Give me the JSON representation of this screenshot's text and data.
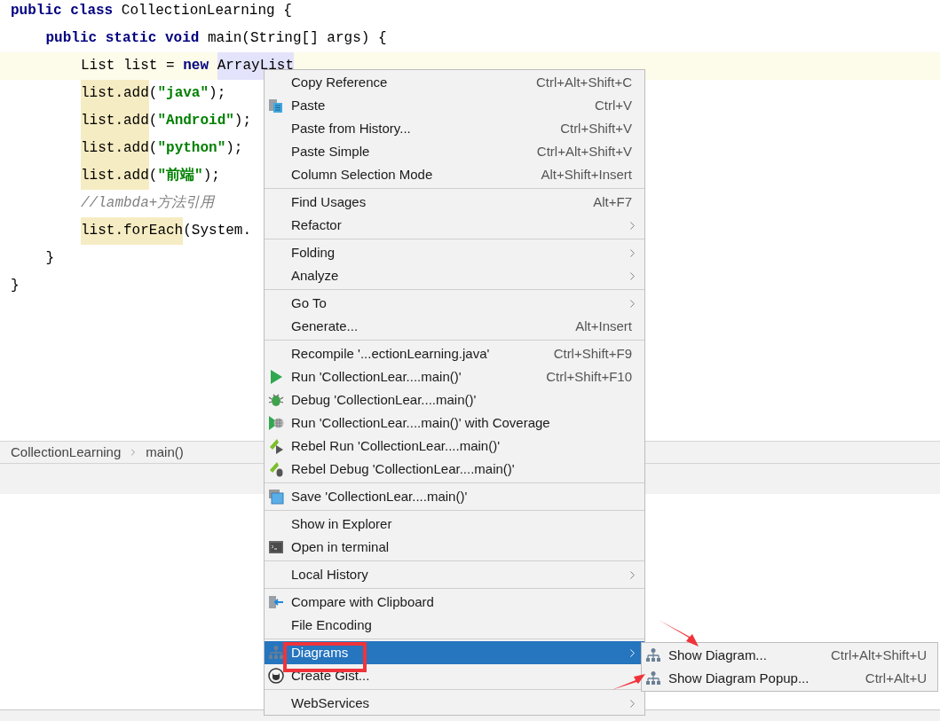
{
  "code": [
    {
      "segments": [
        {
          "text": "public class ",
          "kind": "keyword"
        },
        {
          "text": "CollectionLearning {",
          "kind": "plain"
        }
      ],
      "current": false,
      "children": [
        {
          "segments": [
            {
              "text": "public static void ",
              "kind": "keyword"
            },
            {
              "text": "main(String[] args) {",
              "kind": "plain"
            }
          ],
          "current": false,
          "children": [
            {
              "segments": [
                {
                  "text": "List list = ",
                  "kind": "plain"
                },
                {
                  "text": "new ",
                  "kind": "keyword"
                },
                {
                  "text": "ArrayList",
                  "kind": "reference"
                }
              ],
              "current": true
            },
            {
              "segments": [
                {
                  "text": "list.add",
                  "kind": "usage"
                },
                {
                  "text": "(",
                  "kind": "plain"
                },
                {
                  "text": "\"java\"",
                  "kind": "string"
                },
                {
                  "text": ");",
                  "kind": "plain"
                }
              ],
              "current": false
            },
            {
              "segments": [
                {
                  "text": "list.add",
                  "kind": "usage"
                },
                {
                  "text": "(",
                  "kind": "plain"
                },
                {
                  "text": "\"Android\"",
                  "kind": "string"
                },
                {
                  "text": ");",
                  "kind": "plain"
                }
              ],
              "current": false
            },
            {
              "segments": [
                {
                  "text": "list.add",
                  "kind": "usage"
                },
                {
                  "text": "(",
                  "kind": "plain"
                },
                {
                  "text": "\"python\"",
                  "kind": "string"
                },
                {
                  "text": ");",
                  "kind": "plain"
                }
              ],
              "current": false
            },
            {
              "segments": [
                {
                  "text": "list.add",
                  "kind": "usage"
                },
                {
                  "text": "(",
                  "kind": "plain"
                },
                {
                  "text": "\"前端\"",
                  "kind": "string"
                },
                {
                  "text": ");",
                  "kind": "plain"
                }
              ],
              "current": false
            },
            {
              "segments": [
                {
                  "text": "//lambda+方法引用",
                  "kind": "comment"
                }
              ],
              "current": false
            },
            {
              "segments": [
                {
                  "text": "list.forEach",
                  "kind": "usage"
                },
                {
                  "text": "(System.",
                  "kind": "plain"
                }
              ],
              "current": false
            }
          ]
        },
        {
          "segments": [
            {
              "text": "}",
              "kind": "plain"
            }
          ],
          "current": false
        }
      ]
    },
    {
      "segments": [
        {
          "text": "}",
          "kind": "plain"
        }
      ],
      "current": false
    }
  ],
  "breadcrumb": [
    "CollectionLearning",
    "main()"
  ],
  "context_menu": {
    "groups": [
      {
        "items": [
          {
            "label": "Copy Reference",
            "shortcut": "Ctrl+Alt+Shift+C",
            "selected": false,
            "submenu": false
          },
          {
            "label": "Paste",
            "shortcut": "Ctrl+V",
            "kind": "paste",
            "selected": false,
            "submenu": false
          },
          {
            "label": "Paste from History...",
            "shortcut": "Ctrl+Shift+V",
            "selected": false,
            "submenu": false
          },
          {
            "label": "Paste Simple",
            "shortcut": "Ctrl+Alt+Shift+V",
            "selected": false,
            "submenu": false
          },
          {
            "label": "Column Selection Mode",
            "shortcut": "Alt+Shift+Insert",
            "selected": false,
            "submenu": false
          }
        ]
      },
      {
        "items": [
          {
            "label": "Find Usages",
            "shortcut": "Alt+F7",
            "selected": false,
            "submenu": false
          },
          {
            "label": "Refactor",
            "selected": false,
            "submenu": true
          }
        ]
      },
      {
        "items": [
          {
            "label": "Folding",
            "selected": false,
            "submenu": true
          },
          {
            "label": "Analyze",
            "selected": false,
            "submenu": true
          }
        ]
      },
      {
        "items": [
          {
            "label": "Go To",
            "selected": false,
            "submenu": true
          },
          {
            "label": "Generate...",
            "shortcut": "Alt+Insert",
            "selected": false,
            "submenu": false
          }
        ]
      },
      {
        "items": [
          {
            "label": "Recompile '...ectionLearning.java'",
            "shortcut": "Ctrl+Shift+F9",
            "selected": false,
            "submenu": false
          },
          {
            "label": "Run 'CollectionLear....main()'",
            "shortcut": "Ctrl+Shift+F10",
            "kind": "run",
            "selected": false,
            "submenu": false
          },
          {
            "label": "Debug 'CollectionLear....main()'",
            "kind": "debug",
            "selected": false,
            "submenu": false
          },
          {
            "label": "Run 'CollectionLear....main()' with Coverage",
            "kind": "coverage",
            "selected": false,
            "submenu": false
          },
          {
            "label": "Rebel Run 'CollectionLear....main()'",
            "kind": "rebel-run",
            "selected": false,
            "submenu": false
          },
          {
            "label": "Rebel Debug 'CollectionLear....main()'",
            "kind": "rebel-debug",
            "selected": false,
            "submenu": false
          }
        ]
      },
      {
        "items": [
          {
            "label": "Save 'CollectionLear....main()'",
            "kind": "save",
            "selected": false,
            "submenu": false
          }
        ]
      },
      {
        "items": [
          {
            "label": "Show in Explorer",
            "selected": false,
            "submenu": false
          },
          {
            "label": "Open in terminal",
            "kind": "terminal",
            "selected": false,
            "submenu": false
          }
        ]
      },
      {
        "items": [
          {
            "label": "Local History",
            "selected": false,
            "submenu": true
          }
        ]
      },
      {
        "items": [
          {
            "label": "Compare with Clipboard",
            "kind": "compare",
            "selected": false,
            "submenu": false
          },
          {
            "label": "File Encoding",
            "selected": false,
            "submenu": false
          }
        ]
      },
      {
        "items": [
          {
            "label": "Diagrams",
            "kind": "diagram",
            "selected": true,
            "submenu": true
          },
          {
            "label": "Create Gist...",
            "kind": "github",
            "selected": false,
            "submenu": false
          }
        ]
      },
      {
        "items": [
          {
            "label": "WebServices",
            "selected": false,
            "submenu": true
          }
        ]
      }
    ]
  },
  "submenu": {
    "items": [
      {
        "label": "Show Diagram...",
        "shortcut": "Ctrl+Alt+Shift+U",
        "kind": "diagram",
        "selected": false
      },
      {
        "label": "Show Diagram Popup...",
        "shortcut": "Ctrl+Alt+U",
        "kind": "diagram",
        "selected": false
      }
    ]
  }
}
